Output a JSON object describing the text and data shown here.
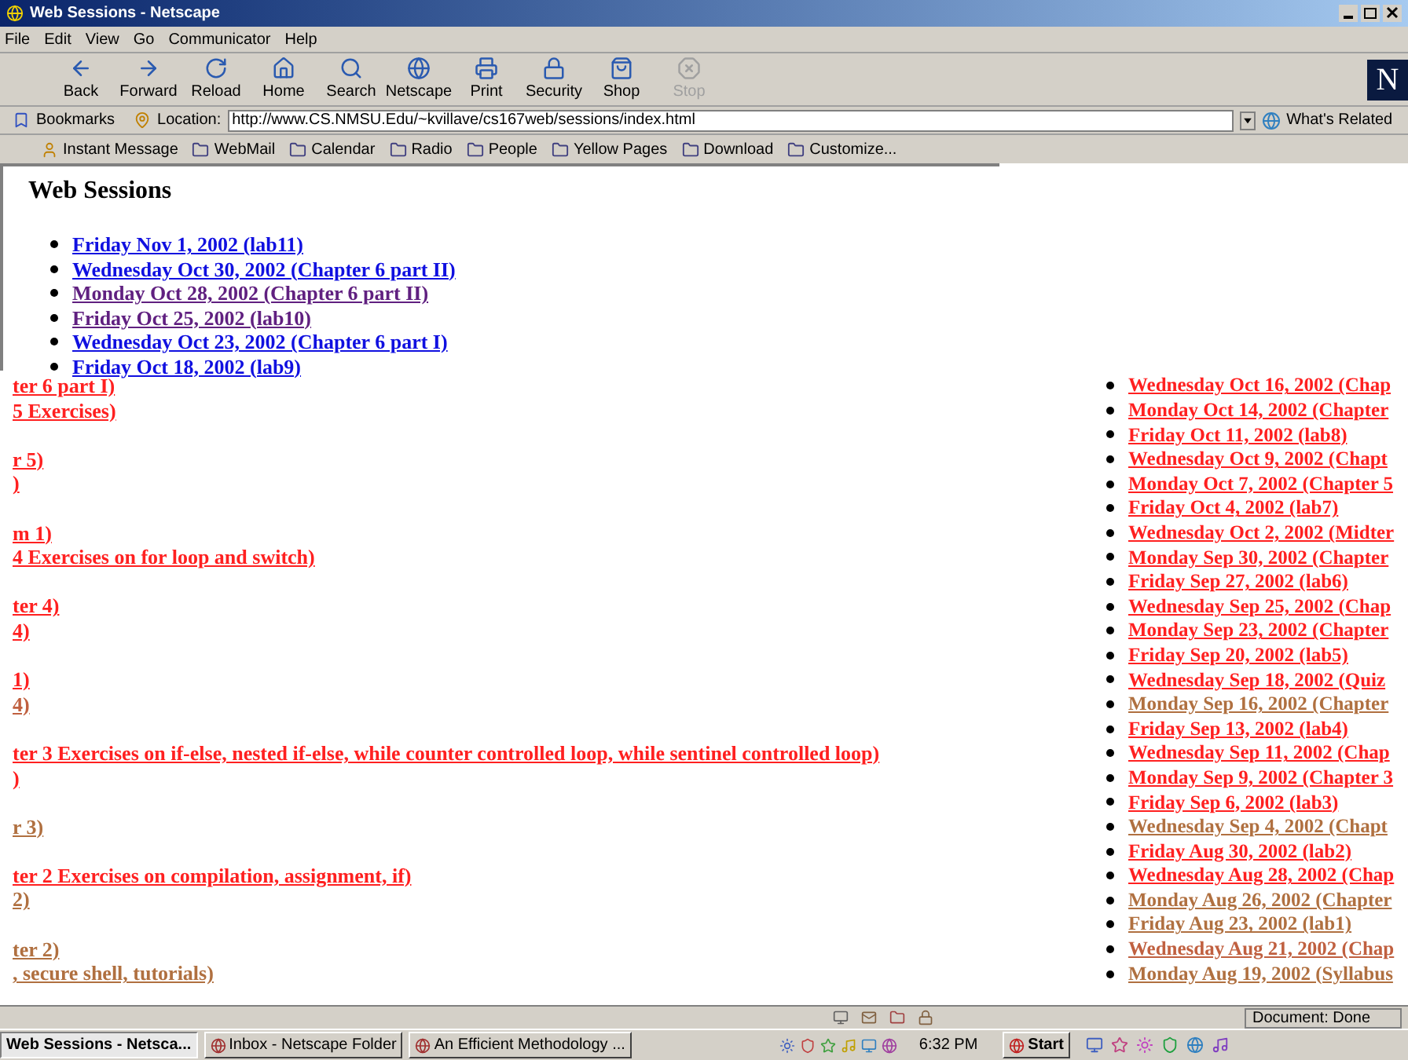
{
  "window": {
    "title": "Web Sessions - Netscape"
  },
  "menu": [
    "File",
    "Edit",
    "View",
    "Go",
    "Communicator",
    "Help"
  ],
  "toolbar": [
    {
      "label": "Back",
      "disabled": false
    },
    {
      "label": "Forward",
      "disabled": false
    },
    {
      "label": "Reload",
      "disabled": false
    },
    {
      "label": "Home",
      "disabled": false
    },
    {
      "label": "Search",
      "disabled": false
    },
    {
      "label": "Netscape",
      "disabled": false
    },
    {
      "label": "Print",
      "disabled": false
    },
    {
      "label": "Security",
      "disabled": false
    },
    {
      "label": "Shop",
      "disabled": false
    },
    {
      "label": "Stop",
      "disabled": true
    }
  ],
  "logo": "N",
  "location_bar": {
    "bookmarks": "Bookmarks",
    "label": "Location:",
    "url": "http://www.CS.NMSU.Edu/~kvillave/cs167web/sessions/index.html",
    "related": "What's Related"
  },
  "personal_toolbar": [
    "Instant Message",
    "WebMail",
    "Calendar",
    "Radio",
    "People",
    "Yellow Pages",
    "Download",
    "Customize..."
  ],
  "page": {
    "heading": "Web Sessions",
    "top_links": [
      {
        "text": "Friday Nov 1, 2002 (lab11)",
        "visited": false
      },
      {
        "text": "Wednesday Oct 30, 2002 (Chapter 6 part II)",
        "visited": false
      },
      {
        "text": "Monday Oct 28, 2002 (Chapter 6 part II)",
        "visited": true
      },
      {
        "text": "Friday Oct 25, 2002 (lab10)",
        "visited": true
      },
      {
        "text": "Wednesday Oct 23, 2002 (Chapter 6 part I)",
        "visited": false
      },
      {
        "text": "Friday Oct 18, 2002 (lab9)",
        "visited": false
      }
    ],
    "left_fragments": [
      [
        {
          "text": "ter 6 part I)",
          "color": "#ff2020"
        },
        {
          "text": "5 Exercises)",
          "color": "#ff2020"
        }
      ],
      [
        {
          "text": "r 5)",
          "color": "#ff2020"
        },
        {
          "text": ")",
          "color": "#ff2020"
        }
      ],
      [
        {
          "text": "m 1)",
          "color": "#ff2020"
        },
        {
          "text": "4 Exercises on for loop and switch)",
          "color": "#ff2020"
        }
      ],
      [
        {
          "text": "ter 4)",
          "color": "#ff2020"
        },
        {
          "text": "4)",
          "color": "#ff2020"
        }
      ],
      [
        {
          "text": "1)",
          "color": "#ff2020"
        },
        {
          "text": "4)",
          "color": "#c06040"
        }
      ],
      [
        {
          "text": "ter 3 Exercises on if-else, nested if-else, while counter controlled loop, while sentinel controlled loop)",
          "color": "#ff2020"
        },
        {
          "text": ")",
          "color": "#ff2020"
        }
      ],
      [
        {
          "text": "r 3)",
          "color": "#b07040"
        }
      ],
      [
        {
          "text": "ter 2 Exercises on compilation, assignment, if)",
          "color": "#ff2020"
        },
        {
          "text": "2)",
          "color": "#b07040"
        }
      ],
      [
        {
          "text": "ter 2)",
          "color": "#b07040"
        },
        {
          "text": ", secure shell, tutorials)",
          "color": "#b07040"
        }
      ]
    ],
    "right_links": [
      {
        "text": "Wednesday Oct 16, 2002 (Chap",
        "color": "#ff2020"
      },
      {
        "text": "Monday Oct 14, 2002 (Chapter",
        "color": "#ff2020"
      },
      {
        "text": "Friday Oct 11, 2002 (lab8)",
        "color": "#ff2020"
      },
      {
        "text": "Wednesday Oct 9, 2002 (Chapt",
        "color": "#ff2020"
      },
      {
        "text": "Monday Oct 7, 2002 (Chapter 5",
        "color": "#ff2020"
      },
      {
        "text": "Friday Oct 4, 2002 (lab7)",
        "color": "#ff2020"
      },
      {
        "text": "Wednesday Oct 2, 2002 (Midter",
        "color": "#ff2020"
      },
      {
        "text": "Monday Sep 30, 2002 (Chapter",
        "color": "#ff2020"
      },
      {
        "text": "Friday Sep 27, 2002 (lab6)",
        "color": "#ff2020"
      },
      {
        "text": "Wednesday Sep 25, 2002 (Chap",
        "color": "#ff2020"
      },
      {
        "text": "Monday Sep 23, 2002 (Chapter",
        "color": "#ff2020"
      },
      {
        "text": "Friday Sep 20, 2002 (lab5)",
        "color": "#ff2020"
      },
      {
        "text": "Wednesday Sep 18, 2002 (Quiz",
        "color": "#ff2020"
      },
      {
        "text": "Monday Sep 16, 2002 (Chapter",
        "color": "#b07040"
      },
      {
        "text": "Friday Sep 13, 2002 (lab4)",
        "color": "#ff2020"
      },
      {
        "text": "Wednesday Sep 11, 2002 (Chap",
        "color": "#ff2020"
      },
      {
        "text": "Monday Sep 9, 2002 (Chapter 3",
        "color": "#ff2020"
      },
      {
        "text": "Friday Sep 6, 2002 (lab3)",
        "color": "#ff2020"
      },
      {
        "text": "Wednesday Sep 4, 2002 (Chapt",
        "color": "#b07040"
      },
      {
        "text": "Friday Aug 30, 2002 (lab2)",
        "color": "#ff2020"
      },
      {
        "text": "Wednesday Aug 28, 2002 (Chap",
        "color": "#ff2020"
      },
      {
        "text": "Monday Aug 26, 2002 (Chapter",
        "color": "#b07040"
      },
      {
        "text": "Friday Aug 23, 2002 (lab1)",
        "color": "#b07040"
      },
      {
        "text": "Wednesday Aug 21, 2002 (Chap",
        "color": "#c06040"
      },
      {
        "text": "Monday Aug 19, 2002 (Syllabus",
        "color": "#b07040"
      }
    ]
  },
  "status_bar": {
    "text": "Document: Done"
  },
  "taskbar": {
    "buttons": [
      {
        "label": "Web Sessions - Netsca...",
        "selected": true
      },
      {
        "label": "Inbox - Netscape Folder",
        "selected": false
      },
      {
        "label": "An Efficient Methodology ...",
        "selected": false
      }
    ],
    "clock": "6:32 PM",
    "start": "Start"
  }
}
